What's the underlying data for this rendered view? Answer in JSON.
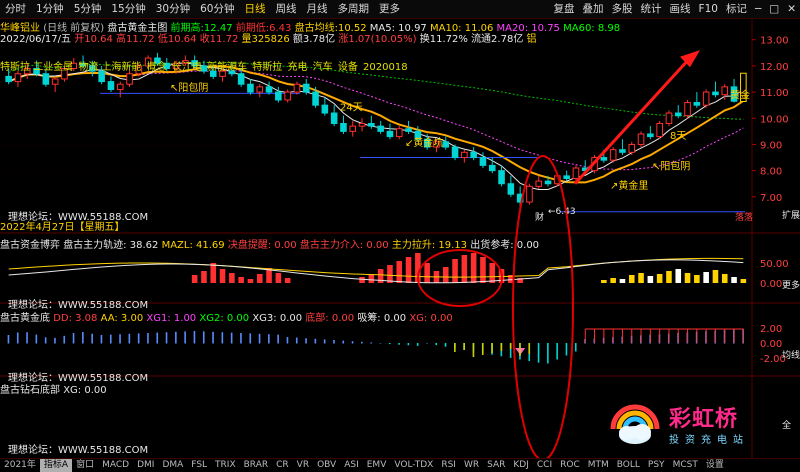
{
  "toolbar": {
    "left": [
      "分时",
      "1分钟",
      "5分钟",
      "15分钟",
      "30分钟",
      "60分钟",
      "日线",
      "周线",
      "月线",
      "多周期",
      "更多"
    ],
    "active": "日线",
    "right": [
      "复盘",
      "叠加",
      "多股",
      "统计",
      "画线",
      "F10",
      "标记"
    ]
  },
  "header": {
    "stock": "华峰铝业",
    "adjust": "(日线 前复权)",
    "indicator": "盘古黄金主图",
    "p1_label": "前期高:",
    "p1_value": "12.47",
    "p2_label": "前期低:",
    "p2_value": "6.43",
    "ma_label": "盘古均线:",
    "ma_value": "10.52",
    "ma5": "MA5: 10.97",
    "ma10": "MA10: 11.06",
    "ma20": "MA20: 10.75",
    "ma60": "MA60: 8.98"
  },
  "info_line": {
    "date": "2022/06/17/五",
    "open": "开10.64",
    "high": "高11.72",
    "low": "低10.64",
    "close": "收11.72",
    "vol": "量325826",
    "amount": "额3.78亿",
    "change": "涨1.07(10.05%)",
    "turnover": "换11.72%",
    "float": "流通2.78亿",
    "tail": "铝"
  },
  "ribbon_texts": [
    "特斯拉 工业金属",
    "",
    "物流 上海新能",
    "概念",
    "长江电",
    "新能源车",
    "",
    "特斯拉",
    "充电",
    "汽车",
    "设备",
    "2020018"
  ],
  "annotations": {
    "yang": "阳包阴",
    "tian": "24天",
    "huangjin1": "黄金坑",
    "huangjin2": "黄金里",
    "tian2": "8天",
    "yang2": "阳包阴",
    "low_price": "6.43",
    "cai": "财",
    "luo": "落落",
    "huang_right": "黄金",
    "date_mark": "2022年4月27日【星期五】",
    "forum": "理想论坛：WWW.55188.COM"
  },
  "y_axis_main": [
    "13.00",
    "12.00",
    "11.00",
    "10.00",
    "9.00",
    "8.00",
    "7.00"
  ],
  "panel2": {
    "title": "盘古资金博弈",
    "items": [
      "盘古主力轨迹: 38.62",
      "MAZL: 41.69",
      "决盘提醒: 0.00",
      "盘古主力介入: 0.00",
      "主力拉升: 19.13",
      "出货参考: 0.00"
    ],
    "forum": "理想论坛：WWW.55188.COM",
    "y_axis": [
      "50.00",
      "0.00"
    ]
  },
  "panel3": {
    "title": "盘古黄金底",
    "items": [
      "DD: 3.08",
      "AA: 3.00",
      "XG1: 1.00",
      "XG2: 0.00",
      "XG3: 0.00",
      "底部: 0.00",
      "吸筹: 0.00",
      "XG: 0.00"
    ],
    "forum": "理想论坛：WWW.55188.COM",
    "y_axis": [
      "2.00",
      "0.00",
      "-2.00"
    ]
  },
  "panel4": {
    "title": "盘古钻石底部",
    "items": [
      "XG: 0.00"
    ],
    "forum": "理想论坛：WWW.55188.COM"
  },
  "bottom": [
    "2021年",
    "指标A",
    "窗口",
    "MACD",
    "DMI",
    "DMA",
    "FSL",
    "TRIX",
    "BRAR",
    "CR",
    "VR",
    "OBV",
    "ASI",
    "EMV",
    "VOL-TDX",
    "RSI",
    "WR",
    "SAR",
    "KDJ",
    "CCI",
    "ROC",
    "MTM",
    "BOLL",
    "PSY",
    "MCST",
    "设置"
  ],
  "bottom_active": "指标A",
  "watermark": {
    "big": "彩虹桥",
    "small": "投资充电站"
  },
  "right_tabs": [
    "扩展指标",
    "更多",
    "均线",
    "全"
  ],
  "colors": {
    "up": "#ff3030",
    "down": "#00d4d4",
    "ma": "#ffaa00",
    "accent": "#ffd200",
    "circle": "#e00000"
  },
  "chart_data": {
    "type": "candlestick",
    "ylim": [
      6.0,
      13.6
    ],
    "candles": [
      [
        11.6,
        11.9,
        11.3,
        11.4
      ],
      [
        11.4,
        11.8,
        11.2,
        11.7
      ],
      [
        11.7,
        12.1,
        11.5,
        11.9
      ],
      [
        11.9,
        12.2,
        11.6,
        11.7
      ],
      [
        11.7,
        11.9,
        11.2,
        11.3
      ],
      [
        11.3,
        11.6,
        11.0,
        11.5
      ],
      [
        11.5,
        12.0,
        11.4,
        11.9
      ],
      [
        11.9,
        12.3,
        11.8,
        12.1
      ],
      [
        12.1,
        12.4,
        11.9,
        12.0
      ],
      [
        12.0,
        12.2,
        11.6,
        11.8
      ],
      [
        11.8,
        12.0,
        11.3,
        11.4
      ],
      [
        11.4,
        11.6,
        11.0,
        11.1
      ],
      [
        11.1,
        11.4,
        10.8,
        11.3
      ],
      [
        11.3,
        11.8,
        11.2,
        11.7
      ],
      [
        11.7,
        12.1,
        11.6,
        12.0
      ],
      [
        12.0,
        12.4,
        11.9,
        12.3
      ],
      [
        12.3,
        12.5,
        12.0,
        12.1
      ],
      [
        12.1,
        12.3,
        11.8,
        11.9
      ],
      [
        11.9,
        12.2,
        11.7,
        12.1
      ],
      [
        12.1,
        12.4,
        12.0,
        12.2
      ],
      [
        12.2,
        12.4,
        11.9,
        12.0
      ],
      [
        12.0,
        12.2,
        11.7,
        11.8
      ],
      [
        11.8,
        12.0,
        11.5,
        11.6
      ],
      [
        11.6,
        11.9,
        11.4,
        11.8
      ],
      [
        11.8,
        12.1,
        11.6,
        11.7
      ],
      [
        11.7,
        11.9,
        11.2,
        11.3
      ],
      [
        11.3,
        11.5,
        10.9,
        11.0
      ],
      [
        11.0,
        11.3,
        10.8,
        11.2
      ],
      [
        11.2,
        11.4,
        10.9,
        11.0
      ],
      [
        11.0,
        11.2,
        10.6,
        10.7
      ],
      [
        10.7,
        11.1,
        10.6,
        11.0
      ],
      [
        11.0,
        11.4,
        10.9,
        11.3
      ],
      [
        11.3,
        11.5,
        10.9,
        11.0
      ],
      [
        11.0,
        11.2,
        10.4,
        10.5
      ],
      [
        10.5,
        10.8,
        10.1,
        10.2
      ],
      [
        10.2,
        10.5,
        9.7,
        9.8
      ],
      [
        9.8,
        10.1,
        9.4,
        9.5
      ],
      [
        9.5,
        9.9,
        9.3,
        9.7
      ],
      [
        9.7,
        10.0,
        9.5,
        9.8
      ],
      [
        9.8,
        10.1,
        9.6,
        9.7
      ],
      [
        9.7,
        9.9,
        9.4,
        9.5
      ],
      [
        9.5,
        9.8,
        9.2,
        9.3
      ],
      [
        9.3,
        9.7,
        9.2,
        9.6
      ],
      [
        9.6,
        9.9,
        9.4,
        9.5
      ],
      [
        9.5,
        9.7,
        9.1,
        9.2
      ],
      [
        9.2,
        9.4,
        8.8,
        8.9
      ],
      [
        8.9,
        9.2,
        8.7,
        9.1
      ],
      [
        9.1,
        9.3,
        8.8,
        8.9
      ],
      [
        8.9,
        9.0,
        8.4,
        8.5
      ],
      [
        8.5,
        8.8,
        8.3,
        8.7
      ],
      [
        8.7,
        8.9,
        8.4,
        8.5
      ],
      [
        8.5,
        8.7,
        8.1,
        8.2
      ],
      [
        8.2,
        8.5,
        7.9,
        8.0
      ],
      [
        8.0,
        8.2,
        7.4,
        7.5
      ],
      [
        7.5,
        7.8,
        7.0,
        7.1
      ],
      [
        7.1,
        7.4,
        6.43,
        6.8
      ],
      [
        6.8,
        7.5,
        6.7,
        7.4
      ],
      [
        7.4,
        7.8,
        7.3,
        7.6
      ],
      [
        7.6,
        7.8,
        7.4,
        7.5
      ],
      [
        7.5,
        7.9,
        7.4,
        7.8
      ],
      [
        7.8,
        8.0,
        7.6,
        7.7
      ],
      [
        7.7,
        8.2,
        7.6,
        8.1
      ],
      [
        8.1,
        8.4,
        7.9,
        8.0
      ],
      [
        8.0,
        8.6,
        7.9,
        8.5
      ],
      [
        8.5,
        8.8,
        8.3,
        8.4
      ],
      [
        8.4,
        8.9,
        8.3,
        8.8
      ],
      [
        8.8,
        9.2,
        8.6,
        8.7
      ],
      [
        8.7,
        9.1,
        8.6,
        9.0
      ],
      [
        9.0,
        9.5,
        8.9,
        9.4
      ],
      [
        9.4,
        9.7,
        9.2,
        9.3
      ],
      [
        9.3,
        9.9,
        9.2,
        9.8
      ],
      [
        9.8,
        10.3,
        9.7,
        10.2
      ],
      [
        10.2,
        10.5,
        10.0,
        10.1
      ],
      [
        10.1,
        10.7,
        10.0,
        10.6
      ],
      [
        10.6,
        11.0,
        10.4,
        10.5
      ],
      [
        10.5,
        11.1,
        10.4,
        11.0
      ],
      [
        11.0,
        11.4,
        10.8,
        10.9
      ],
      [
        10.9,
        11.3,
        10.7,
        11.2
      ],
      [
        11.2,
        11.5,
        10.6,
        10.65
      ],
      [
        10.64,
        11.72,
        10.64,
        11.72
      ]
    ]
  }
}
